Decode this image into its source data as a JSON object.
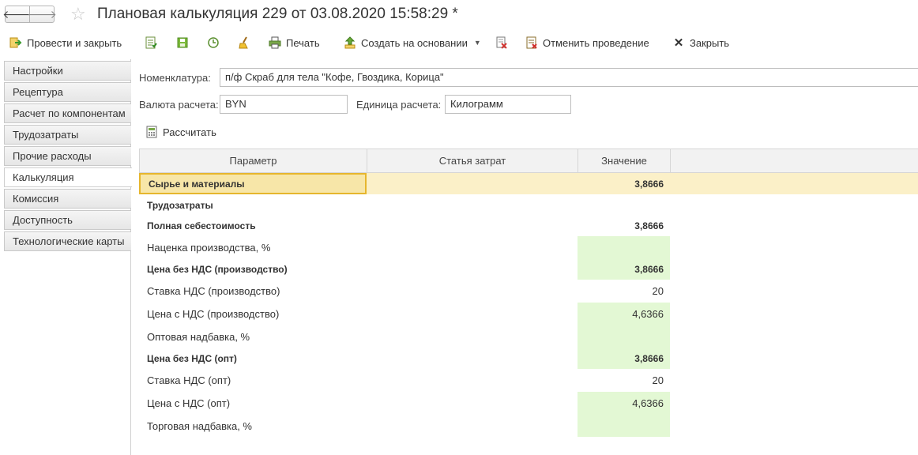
{
  "window": {
    "title": "Плановая калькуляция 229 от 03.08.2020 15:58:29 *",
    "nav_back": "🡐",
    "nav_forward": "🡒"
  },
  "toolbar": {
    "post_close_label": "Провести и закрыть",
    "print_label": "Печать",
    "create_based_label": "Создать на основании",
    "cancel_posting_label": "Отменить проведение",
    "close_label": "Закрыть"
  },
  "sidebar": {
    "items": [
      {
        "label": "Настройки"
      },
      {
        "label": "Рецептура"
      },
      {
        "label": "Расчет по компонентам"
      },
      {
        "label": "Трудозатраты"
      },
      {
        "label": "Прочие расходы"
      },
      {
        "label": "Калькуляция"
      },
      {
        "label": "Комиссия"
      },
      {
        "label": "Доступность"
      },
      {
        "label": "Технологические карты"
      }
    ],
    "active_index": 5
  },
  "form": {
    "nomenclature_label": "Номенклатура:",
    "nomenclature_value": "п/ф Скраб для тела \"Кофе, Гвоздика, Корица\"",
    "currency_label": "Валюта расчета:",
    "currency_value": "BYN",
    "unit_label": "Единица расчета:",
    "unit_value": "Килограмм",
    "calculate_label": "Рассчитать"
  },
  "table": {
    "headers": {
      "param": "Параметр",
      "cost_item": "Статья затрат",
      "value": "Значение"
    },
    "rows": [
      {
        "param": "Сырье и материалы",
        "cost_item": "",
        "value": "3,8666"
      },
      {
        "param": "Трудозатраты",
        "cost_item": "",
        "value": ""
      },
      {
        "param": "Полная себестоимость",
        "cost_item": "",
        "value": "3,8666"
      },
      {
        "param": "Наценка производства, %",
        "cost_item": "",
        "value": ""
      },
      {
        "param": "Цена без НДС (производство)",
        "cost_item": "",
        "value": "3,8666"
      },
      {
        "param": "Ставка НДС (производство)",
        "cost_item": "",
        "value": "20"
      },
      {
        "param": "Цена с НДС (производство)",
        "cost_item": "",
        "value": "4,6366"
      },
      {
        "param": "Оптовая надбавка, %",
        "cost_item": "",
        "value": ""
      },
      {
        "param": "Цена без НДС (опт)",
        "cost_item": "",
        "value": "3,8666"
      },
      {
        "param": "Ставка НДС (опт)",
        "cost_item": "",
        "value": "20"
      },
      {
        "param": "Цена с НДС (опт)",
        "cost_item": "",
        "value": "4,6366"
      },
      {
        "param": "Торговая надбавка, %",
        "cost_item": "",
        "value": ""
      }
    ]
  },
  "colors": {
    "editable_cell": "#e3f8d4",
    "selected_row": "#fbf0c8",
    "focus_border": "#e6b62d"
  }
}
